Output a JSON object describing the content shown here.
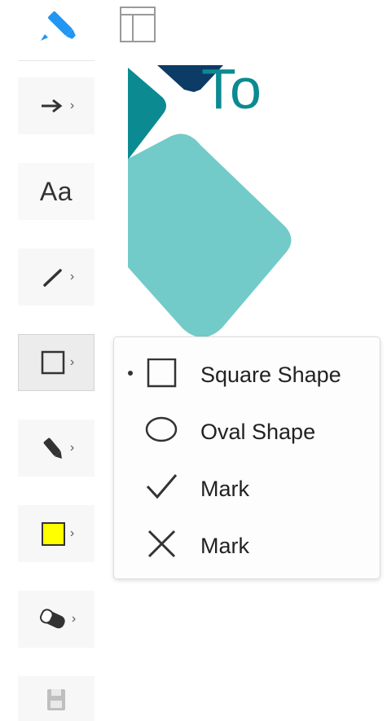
{
  "toolbar": {
    "items": [
      {
        "name": "highlighter",
        "icon": "highlighter-icon"
      },
      {
        "name": "arrow",
        "icon": "arrow-right-icon",
        "has_submenu": true
      },
      {
        "name": "text",
        "label": "Aa"
      },
      {
        "name": "line",
        "icon": "line-icon",
        "has_submenu": true
      },
      {
        "name": "shape",
        "icon": "square-icon",
        "has_submenu": true,
        "selected": true
      },
      {
        "name": "pen",
        "icon": "pen-icon",
        "has_submenu": true
      },
      {
        "name": "fill-color",
        "icon": "color-swatch-icon",
        "has_submenu": true,
        "color": "#ffff00"
      },
      {
        "name": "eraser",
        "icon": "eraser-icon",
        "has_submenu": true
      },
      {
        "name": "save",
        "icon": "save-icon",
        "disabled": true
      }
    ],
    "chevron": "›",
    "accent_color": "#2196f3"
  },
  "panel_toggle": {
    "icon": "sidebar-panel-icon"
  },
  "slide": {
    "title_fragment": "To",
    "colors": {
      "dark_navy": "#0c3b66",
      "teal": "#0b8a91",
      "light_teal": "#72cbc8",
      "title": "#0b8a91"
    }
  },
  "shape_menu": {
    "items": [
      {
        "label": "Square Shape",
        "icon": "square-icon",
        "selected": true
      },
      {
        "label": "Oval Shape",
        "icon": "oval-icon",
        "selected": false
      },
      {
        "label": "Mark",
        "icon": "checkmark-icon",
        "selected": false
      },
      {
        "label": "Mark",
        "icon": "x-mark-icon",
        "selected": false
      }
    ]
  }
}
